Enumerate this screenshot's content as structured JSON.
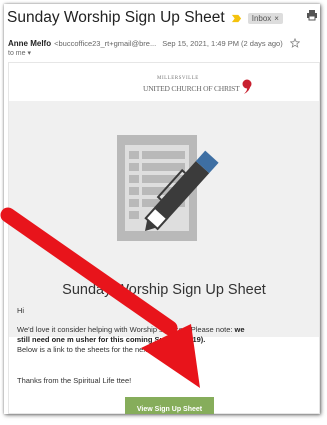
{
  "email": {
    "subject": "Sunday Worship Sign Up Sheet",
    "label_chip": "Inbox",
    "sender_name": "Anne Melfo",
    "sender_address": "<buccoffice23_rt+gmail@bre...",
    "date": "Sep 15, 2021, 1:49 PM (2 days ago)",
    "recipient": "to me"
  },
  "logo": {
    "line_small": "MILLERSVILLE",
    "line_main": "UNITED CHURCH OF CHRIST"
  },
  "content": {
    "hero_title": "Sunday Worship Sign Up Sheet",
    "greeting": "Hi",
    "para1_start": "We'd love it",
    "para1_cont": "consider helping with Worship services. Please note: ",
    "para1_bold1": "we",
    "para1_bold2": "still need one m",
    "para1_bold3": "usher for this coming Sunday (9/19).",
    "para2_start": "Below is a link to the",
    "para2_end": "sheets for the next few weeks.",
    "thanks_start": "Thanks from the Spiritual Life",
    "thanks_end": "ttee!",
    "button_label": "View Sign Up Sheet"
  },
  "colors": {
    "button": "#86ad5b",
    "arrow": "#e8141b",
    "important_marker": "#f4c20d"
  }
}
